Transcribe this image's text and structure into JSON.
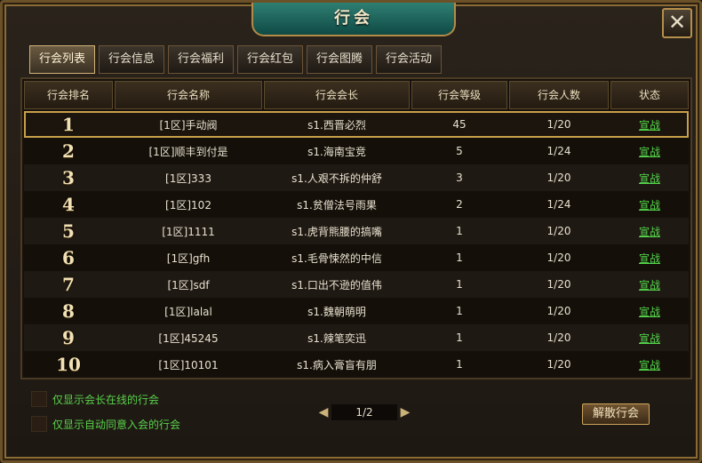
{
  "window": {
    "title": "行会",
    "close_symbol": "✕"
  },
  "tabs": [
    {
      "label": "行会列表",
      "active": true
    },
    {
      "label": "行会信息",
      "active": false
    },
    {
      "label": "行会福利",
      "active": false
    },
    {
      "label": "行会红包",
      "active": false
    },
    {
      "label": "行会图腾",
      "active": false
    },
    {
      "label": "行会活动",
      "active": false
    }
  ],
  "table": {
    "headers": [
      "行会排名",
      "行会名称",
      "行会会长",
      "行会等级",
      "行会人数",
      "状态"
    ],
    "rows": [
      {
        "rank": "1",
        "name": "[1区]手动阀",
        "leader": "s1.西晋必烈",
        "level": "45",
        "members": "1/20",
        "action": "宣战",
        "selected": true
      },
      {
        "rank": "2",
        "name": "[1区]顺丰到付是",
        "leader": "s1.海南宝竞",
        "level": "5",
        "members": "1/24",
        "action": "宣战"
      },
      {
        "rank": "3",
        "name": "[1区]333",
        "leader": "s1.人艰不拆的仲舒",
        "level": "3",
        "members": "1/20",
        "action": "宣战"
      },
      {
        "rank": "4",
        "name": "[1区]102",
        "leader": "s1.贫僧法号雨果",
        "level": "2",
        "members": "1/24",
        "action": "宣战"
      },
      {
        "rank": "5",
        "name": "[1区]1111",
        "leader": "s1.虎背熊腰的搞嘴",
        "level": "1",
        "members": "1/20",
        "action": "宣战"
      },
      {
        "rank": "6",
        "name": "[1区]gfh",
        "leader": "s1.毛骨悚然的中信",
        "level": "1",
        "members": "1/20",
        "action": "宣战"
      },
      {
        "rank": "7",
        "name": "[1区]sdf",
        "leader": "s1.口出不逊的值伟",
        "level": "1",
        "members": "1/20",
        "action": "宣战"
      },
      {
        "rank": "8",
        "name": "[1区]lalal",
        "leader": "s1.魏朝萌明",
        "level": "1",
        "members": "1/20",
        "action": "宣战"
      },
      {
        "rank": "9",
        "name": "[1区]45245",
        "leader": "s1.辣笔奕迅",
        "level": "1",
        "members": "1/20",
        "action": "宣战"
      },
      {
        "rank": "10",
        "name": "[1区]10101",
        "leader": "s1.病入膏盲有朋",
        "level": "1",
        "members": "1/20",
        "action": "宣战"
      }
    ]
  },
  "filters": {
    "online_leader": "仅显示会长在线的行会",
    "auto_accept": "仅显示自动同意入会的行会"
  },
  "pager": {
    "value": "1/2",
    "prev_symbol": "◀",
    "next_symbol": "▶"
  },
  "actions": {
    "disband": "解散行会"
  },
  "colors": {
    "accent_gold": "#c9a04a",
    "link_green": "#55d74c",
    "title_teal": "#2f7f73"
  }
}
